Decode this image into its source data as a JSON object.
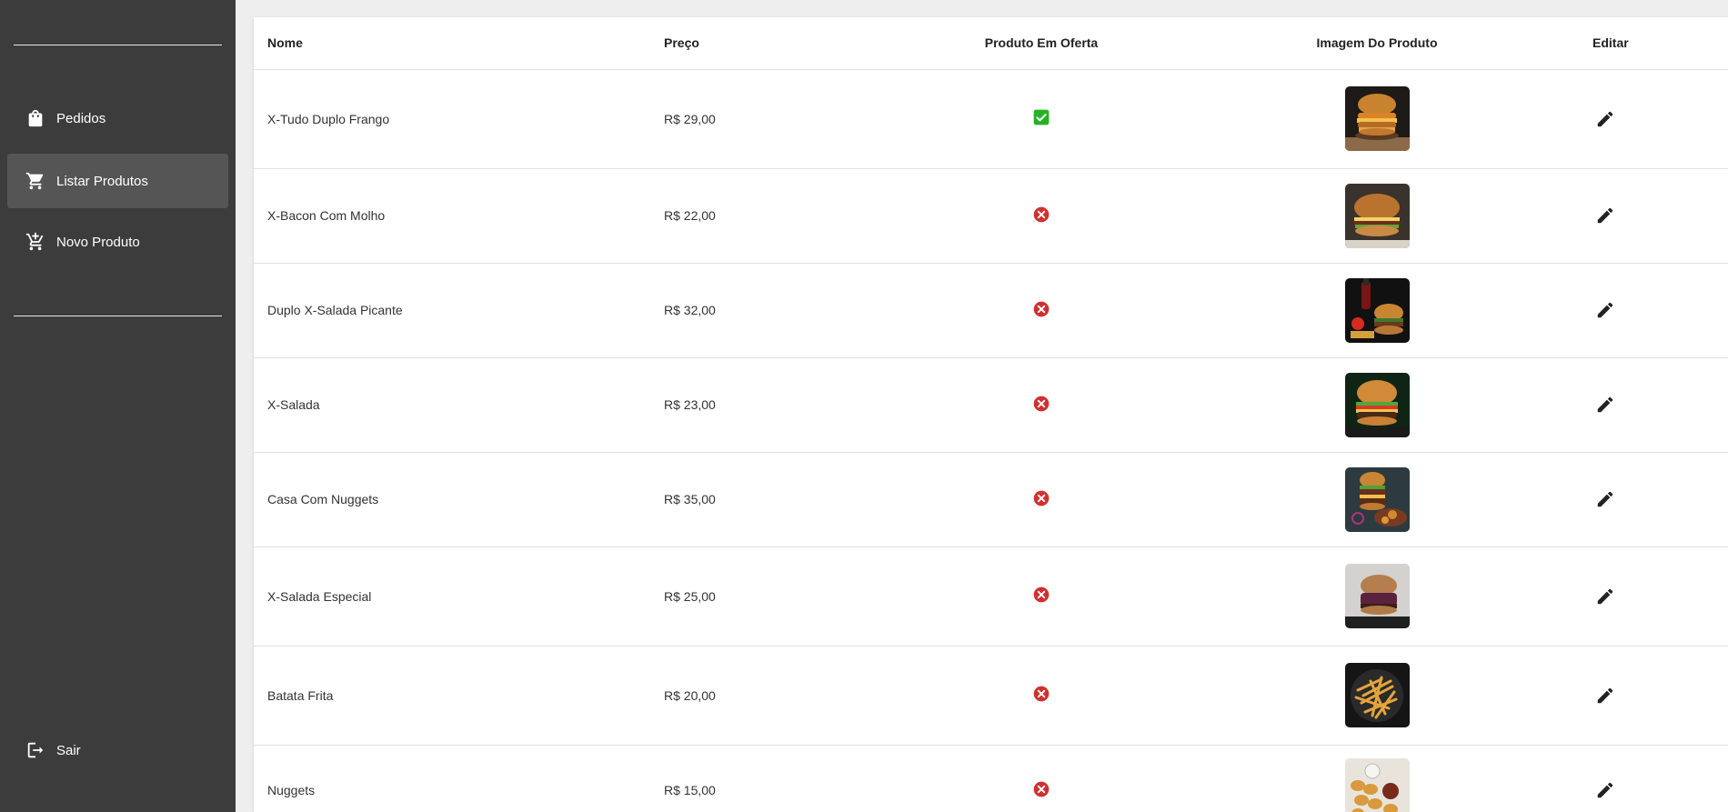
{
  "sidebar": {
    "items": [
      {
        "label": "Pedidos",
        "icon": "shopping-bag-icon"
      },
      {
        "label": "Listar Produtos",
        "icon": "shopping-cart-icon",
        "active": true
      },
      {
        "label": "Novo Produto",
        "icon": "add-shopping-cart-icon"
      }
    ],
    "logout": {
      "label": "Sair",
      "icon": "logout-icon"
    }
  },
  "table": {
    "headers": {
      "nome": "Nome",
      "preco": "Preço",
      "oferta": "Produto Em Oferta",
      "imagem": "Imagem Do Produto",
      "editar": "Editar"
    },
    "rows": [
      {
        "nome": "X-Tudo Duplo Frango",
        "preco": "R$ 29,00",
        "oferta": true,
        "imagem": "chicken-burger-photo"
      },
      {
        "nome": "X-Bacon Com Molho",
        "preco": "R$ 22,00",
        "oferta": false,
        "imagem": "bacon-burger-photo"
      },
      {
        "nome": "Duplo X-Salada Picante",
        "preco": "R$ 32,00",
        "oferta": false,
        "imagem": "spicy-burger-photo"
      },
      {
        "nome": "X-Salada",
        "preco": "R$ 23,00",
        "oferta": false,
        "imagem": "salad-burger-photo"
      },
      {
        "nome": "Casa Com Nuggets",
        "preco": "R$ 35,00",
        "oferta": false,
        "imagem": "burger-nuggets-photo"
      },
      {
        "nome": "X-Salada Especial",
        "preco": "R$ 25,00",
        "oferta": false,
        "imagem": "special-burger-photo"
      },
      {
        "nome": "Batata Frita",
        "preco": "R$ 20,00",
        "oferta": false,
        "imagem": "fries-photo"
      },
      {
        "nome": "Nuggets",
        "preco": "R$ 15,00",
        "oferta": false,
        "imagem": "nuggets-photo"
      }
    ]
  },
  "colors": {
    "sidebar_bg": "#3c3c3c",
    "sidebar_active": "#555555",
    "check_green": "#22b422",
    "cross_red": "#d32f2f"
  }
}
